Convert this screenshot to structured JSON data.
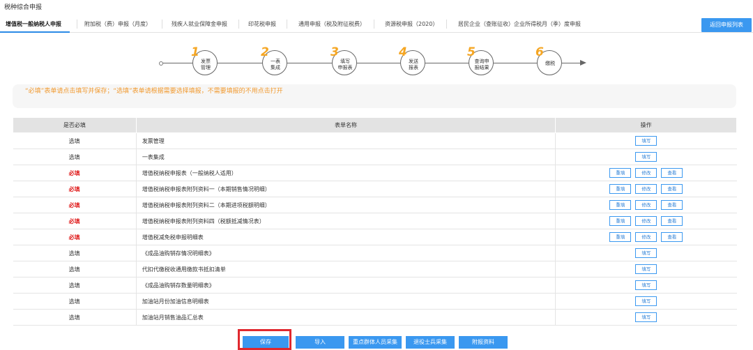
{
  "page": {
    "title": "税种综合申报"
  },
  "tabs": [
    {
      "label": "增值税一般纳税人申报",
      "active": true
    },
    {
      "label": "附加税（费）申报（月度）"
    },
    {
      "label": "残疾人就业保障金申报"
    },
    {
      "label": "印花税申报"
    },
    {
      "label": "通用申报（税及附征税费）"
    },
    {
      "label": "资源税申报（2020）"
    },
    {
      "label": "居民企业（查账征收）企业所得税月（季）度申报"
    }
  ],
  "return_button": "返回申报列表",
  "steps": [
    {
      "num": "1",
      "label": [
        "发票",
        "管理"
      ]
    },
    {
      "num": "2",
      "label": [
        "一表",
        "集成"
      ]
    },
    {
      "num": "3",
      "label": [
        "填写",
        "申报表"
      ]
    },
    {
      "num": "4",
      "label": [
        "发送",
        "报表"
      ]
    },
    {
      "num": "5",
      "label": [
        "查询申",
        "报结果"
      ]
    },
    {
      "num": "6",
      "label": [
        "缴税"
      ]
    }
  ],
  "notice": "“必填”表单请点击填写并保存；“选填”表单请根据需要选择填报，不需要填报的不用点击打开",
  "table": {
    "headers": [
      "是否必填",
      "表单名称",
      "操作"
    ],
    "ops_labels": {
      "fill": "填写",
      "refill": "重填",
      "modify": "修改",
      "view": "查看"
    },
    "rows": [
      {
        "required": "选填",
        "must": false,
        "name": "发票管理",
        "ops": [
          "fill"
        ]
      },
      {
        "required": "选填",
        "must": false,
        "name": "一表集成",
        "ops": [
          "fill"
        ]
      },
      {
        "required": "必填",
        "must": true,
        "name": "增值税纳税申报表（一般纳税人适用）",
        "ops": [
          "refill",
          "modify",
          "view"
        ]
      },
      {
        "required": "必填",
        "must": true,
        "name": "增值税纳税申报表附列资料一（本期销售情况明细）",
        "ops": [
          "refill",
          "modify",
          "view"
        ]
      },
      {
        "required": "必填",
        "must": true,
        "name": "增值税纳税申报表附列资料二（本期进项税额明细）",
        "ops": [
          "refill",
          "modify",
          "view"
        ]
      },
      {
        "required": "必填",
        "must": true,
        "name": "增值税纳税申报表附列资料四（税额抵减情况表）",
        "ops": [
          "refill",
          "modify",
          "view"
        ]
      },
      {
        "required": "必填",
        "must": true,
        "name": "增值税减免税申报明细表",
        "ops": [
          "refill",
          "modify",
          "view"
        ]
      },
      {
        "required": "选填",
        "must": false,
        "name": "《成品油购销存情况明细表》",
        "ops": [
          "fill"
        ]
      },
      {
        "required": "选填",
        "must": false,
        "name": "代扣代缴税收通用缴款书抵扣清单",
        "ops": [
          "fill"
        ]
      },
      {
        "required": "选填",
        "must": false,
        "name": "《成品油购销存数量明细表》",
        "ops": [
          "fill"
        ]
      },
      {
        "required": "选填",
        "must": false,
        "name": "加油站月份加油信息明细表",
        "ops": [
          "fill"
        ]
      },
      {
        "required": "选填",
        "must": false,
        "name": "加油站月销售油品汇总表",
        "ops": [
          "fill"
        ]
      }
    ]
  },
  "bottom_buttons": {
    "save": "保存",
    "import": "导入",
    "key_group": "重点群体人员采集",
    "veteran": "退役士兵采集",
    "attachment": "附报资料"
  },
  "colors": {
    "accent": "#3a98f0",
    "required": "#e02020",
    "notice": "#f19a30",
    "step_number": "#f5a623",
    "highlight": "#e0282e"
  }
}
